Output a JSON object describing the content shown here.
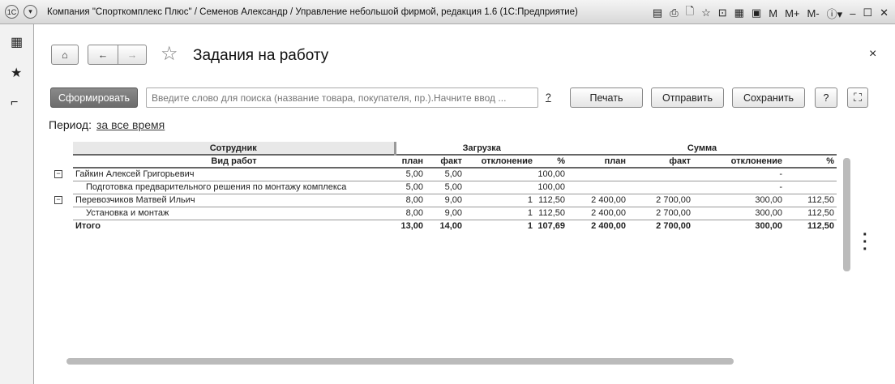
{
  "window": {
    "title": "Компания \"Спорткомплекс Плюс\" / Семенов Александр / Управление небольшой фирмой, редакция 1.6  (1С:Предприятие)",
    "icons": [
      "M",
      "M+",
      "M-"
    ]
  },
  "page": {
    "title": "Задания на работу",
    "close": "×"
  },
  "toolbar": {
    "generate": "Сформировать",
    "search_placeholder": "Введите слово для поиска (название товара, покупателя, пр.).Начните ввод ...",
    "search_help": "?",
    "print": "Печать",
    "send": "Отправить",
    "save": "Сохранить",
    "help": "?"
  },
  "period": {
    "label": "Период:",
    "value": "за все время"
  },
  "report": {
    "groups": {
      "employee": "Сотрудник",
      "load": "Загрузка",
      "sum": "Сумма"
    },
    "subheader": {
      "work": "Вид работ",
      "cols": [
        "план",
        "факт",
        "отклонение",
        "%",
        "план",
        "факт",
        "отклонение",
        "%"
      ]
    },
    "rows": [
      {
        "name": "Гайкин Алексей Григорьевич",
        "level": 0,
        "v": [
          "5,00",
          "5,00",
          "",
          "100,00",
          "",
          "",
          "-",
          ""
        ]
      },
      {
        "name": "Подготовка предварительного решения по монтажу комплекса",
        "level": 1,
        "v": [
          "5,00",
          "5,00",
          "",
          "100,00",
          "",
          "",
          "-",
          ""
        ]
      },
      {
        "name": "Перевозчиков Матвей Ильич",
        "level": 0,
        "v": [
          "8,00",
          "9,00",
          "1",
          "112,50",
          "2 400,00",
          "2 700,00",
          "300,00",
          "112,50"
        ]
      },
      {
        "name": "Установка и монтаж",
        "level": 1,
        "v": [
          "8,00",
          "9,00",
          "1",
          "112,50",
          "2 400,00",
          "2 700,00",
          "300,00",
          "112,50"
        ]
      }
    ],
    "total": {
      "name": "Итого",
      "v": [
        "13,00",
        "14,00",
        "1",
        "107,69",
        "2 400,00",
        "2 700,00",
        "300,00",
        "112,50"
      ]
    }
  }
}
